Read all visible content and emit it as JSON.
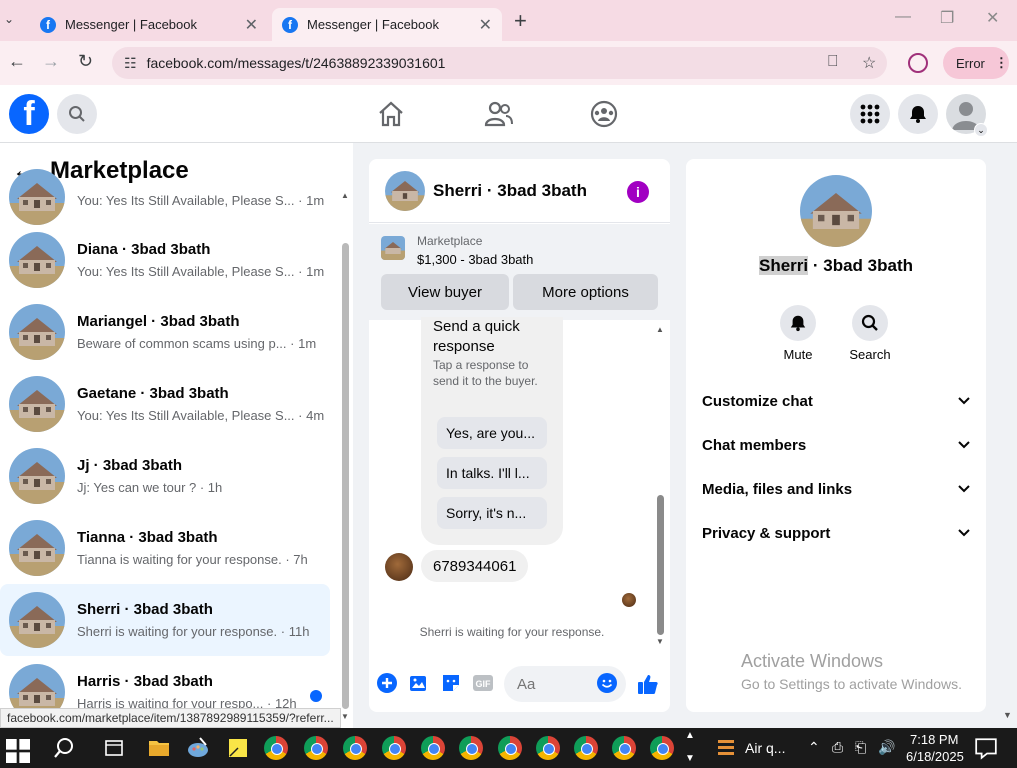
{
  "browser": {
    "tabs": [
      {
        "title": "Messenger | Facebook",
        "active": false
      },
      {
        "title": "Messenger | Facebook",
        "active": true
      }
    ],
    "new_tab": "+",
    "url": "facebook.com/messages/t/24638892339031601",
    "error_label": "Error",
    "status_url": "facebook.com/marketplace/item/1387892989115359/?referr..."
  },
  "sidebar": {
    "title": "Marketplace",
    "conversations": [
      {
        "name": "",
        "snippet": "You: Yes Its Still Available, Please S... · 1m"
      },
      {
        "name": "Diana · 3bad 3bath",
        "snippet": "You: Yes Its Still Available, Please S... · 1m"
      },
      {
        "name": "Mariangel · 3bad 3bath",
        "snippet": "Beware of common scams using p... · 1m"
      },
      {
        "name": "Gaetane · 3bad 3bath",
        "snippet": "You: Yes Its Still Available, Please S... · 4m"
      },
      {
        "name": "Jj · 3bad 3bath",
        "snippet": "Jj: Yes can we tour ? · 1h"
      },
      {
        "name": "Tianna · 3bad 3bath",
        "snippet": "Tianna is waiting for your response. · 7h"
      },
      {
        "name": "Sherri · 3bad 3bath",
        "snippet": "Sherri is waiting for your response. · 11h"
      },
      {
        "name": "Harris · 3bad 3bath",
        "snippet": "Harris is waiting for your respo... · 12h"
      }
    ]
  },
  "chat": {
    "title": "Sherri · 3bad 3bath",
    "marketplace_label": "Marketplace",
    "listing": "$1,300 - 3bad 3bath",
    "view_buyer": "View buyer",
    "more_options": "More options",
    "quick_title": "Send a quick response",
    "quick_desc": "Tap a response to send it to the buyer.",
    "quick_options": [
      "Yes, are you...",
      "In talks. I'll l...",
      "Sorry, it's n..."
    ],
    "message": "6789344061",
    "waiting": "Sherri is waiting for your response.",
    "input_placeholder": "Aa"
  },
  "details": {
    "name_first": "Sherri",
    "name_rest": " · 3bad 3bath",
    "actions": [
      "Mute",
      "Search"
    ],
    "sections": [
      "Customize chat",
      "Chat members",
      "Media, files and links",
      "Privacy & support"
    ],
    "watermark_title": "Activate Windows",
    "watermark_sub": "Go to Settings to activate Windows."
  },
  "taskbar": {
    "app_label": "Air q...",
    "time": "7:18 PM",
    "date": "6/18/2025"
  },
  "colors": {
    "fb_blue": "#0866ff",
    "info_purple": "#a100c2",
    "selected_row": "#ebf5ff"
  }
}
